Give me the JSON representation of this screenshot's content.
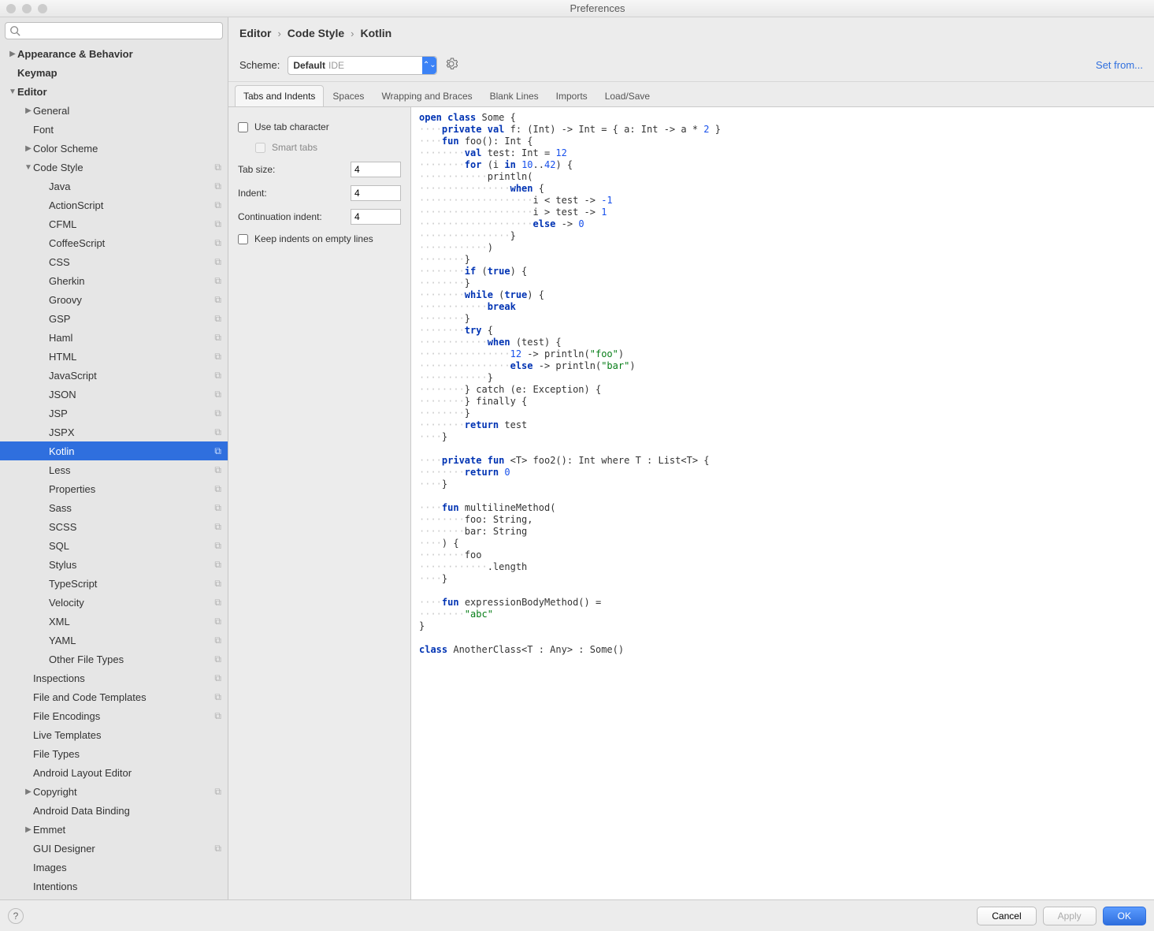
{
  "window": {
    "title": "Preferences"
  },
  "search": {
    "placeholder": ""
  },
  "tree": [
    {
      "label": "Appearance & Behavior",
      "bold": true,
      "indent": 0,
      "disclosure": "right"
    },
    {
      "label": "Keymap",
      "bold": true,
      "indent": 0
    },
    {
      "label": "Editor",
      "bold": true,
      "indent": 0,
      "disclosure": "down"
    },
    {
      "label": "General",
      "indent": 1,
      "disclosure": "right"
    },
    {
      "label": "Font",
      "indent": 1
    },
    {
      "label": "Color Scheme",
      "indent": 1,
      "disclosure": "right"
    },
    {
      "label": "Code Style",
      "indent": 1,
      "disclosure": "down",
      "copy": true
    },
    {
      "label": "Java",
      "indent": 2,
      "copy": true
    },
    {
      "label": "ActionScript",
      "indent": 2,
      "copy": true
    },
    {
      "label": "CFML",
      "indent": 2,
      "copy": true
    },
    {
      "label": "CoffeeScript",
      "indent": 2,
      "copy": true
    },
    {
      "label": "CSS",
      "indent": 2,
      "copy": true
    },
    {
      "label": "Gherkin",
      "indent": 2,
      "copy": true
    },
    {
      "label": "Groovy",
      "indent": 2,
      "copy": true
    },
    {
      "label": "GSP",
      "indent": 2,
      "copy": true
    },
    {
      "label": "Haml",
      "indent": 2,
      "copy": true
    },
    {
      "label": "HTML",
      "indent": 2,
      "copy": true
    },
    {
      "label": "JavaScript",
      "indent": 2,
      "copy": true
    },
    {
      "label": "JSON",
      "indent": 2,
      "copy": true
    },
    {
      "label": "JSP",
      "indent": 2,
      "copy": true
    },
    {
      "label": "JSPX",
      "indent": 2,
      "copy": true
    },
    {
      "label": "Kotlin",
      "indent": 2,
      "copy": true,
      "selected": true
    },
    {
      "label": "Less",
      "indent": 2,
      "copy": true
    },
    {
      "label": "Properties",
      "indent": 2,
      "copy": true
    },
    {
      "label": "Sass",
      "indent": 2,
      "copy": true
    },
    {
      "label": "SCSS",
      "indent": 2,
      "copy": true
    },
    {
      "label": "SQL",
      "indent": 2,
      "copy": true
    },
    {
      "label": "Stylus",
      "indent": 2,
      "copy": true
    },
    {
      "label": "TypeScript",
      "indent": 2,
      "copy": true
    },
    {
      "label": "Velocity",
      "indent": 2,
      "copy": true
    },
    {
      "label": "XML",
      "indent": 2,
      "copy": true
    },
    {
      "label": "YAML",
      "indent": 2,
      "copy": true
    },
    {
      "label": "Other File Types",
      "indent": 2,
      "copy": true
    },
    {
      "label": "Inspections",
      "indent": 1,
      "copy": true
    },
    {
      "label": "File and Code Templates",
      "indent": 1,
      "copy": true
    },
    {
      "label": "File Encodings",
      "indent": 1,
      "copy": true
    },
    {
      "label": "Live Templates",
      "indent": 1
    },
    {
      "label": "File Types",
      "indent": 1
    },
    {
      "label": "Android Layout Editor",
      "indent": 1
    },
    {
      "label": "Copyright",
      "indent": 1,
      "disclosure": "right",
      "copy": true
    },
    {
      "label": "Android Data Binding",
      "indent": 1
    },
    {
      "label": "Emmet",
      "indent": 1,
      "disclosure": "right"
    },
    {
      "label": "GUI Designer",
      "indent": 1,
      "copy": true
    },
    {
      "label": "Images",
      "indent": 1
    },
    {
      "label": "Intentions",
      "indent": 1
    }
  ],
  "breadcrumb": {
    "a": "Editor",
    "b": "Code Style",
    "c": "Kotlin"
  },
  "scheme": {
    "label": "Scheme:",
    "value": "Default",
    "suffix": "IDE",
    "set_from": "Set from..."
  },
  "tabs": {
    "items": [
      "Tabs and Indents",
      "Spaces",
      "Wrapping and Braces",
      "Blank Lines",
      "Imports",
      "Load/Save"
    ],
    "active": 0
  },
  "settings": {
    "use_tab": "Use tab character",
    "smart_tabs": "Smart tabs",
    "tab_size_label": "Tab size:",
    "tab_size": "4",
    "indent_label": "Indent:",
    "indent": "4",
    "cont_label": "Continuation indent:",
    "cont": "4",
    "keep_empty": "Keep indents on empty lines"
  },
  "code": [
    {
      "t": [
        [
          "kw",
          "open"
        ],
        [
          "",
          " "
        ],
        [
          "kw",
          "class"
        ],
        [
          "",
          " Some {"
        ]
      ]
    },
    {
      "d": 4,
      "t": [
        [
          "kw",
          "private"
        ],
        [
          "",
          " "
        ],
        [
          "kw",
          "val"
        ],
        [
          "",
          " f: (Int) -> Int = { a: Int -> a * "
        ],
        [
          "num",
          "2"
        ],
        [
          "",
          " }"
        ]
      ]
    },
    {
      "d": 4,
      "t": [
        [
          "kw",
          "fun"
        ],
        [
          "",
          " foo(): Int {"
        ]
      ]
    },
    {
      "d": 8,
      "t": [
        [
          "kw",
          "val"
        ],
        [
          "",
          " test: Int = "
        ],
        [
          "num",
          "12"
        ]
      ]
    },
    {
      "d": 8,
      "t": [
        [
          "kw",
          "for"
        ],
        [
          "",
          " (i "
        ],
        [
          "kw",
          "in"
        ],
        [
          "",
          " "
        ],
        [
          "num",
          "10"
        ],
        [
          "",
          ".."
        ],
        [
          "num",
          "42"
        ],
        [
          "",
          ") {"
        ]
      ]
    },
    {
      "d": 12,
      "t": [
        [
          "",
          "println("
        ]
      ]
    },
    {
      "d": 16,
      "t": [
        [
          "kw",
          "when"
        ],
        [
          "",
          " {"
        ]
      ]
    },
    {
      "d": 20,
      "t": [
        [
          "",
          "i < test -> "
        ],
        [
          "num",
          "-1"
        ]
      ]
    },
    {
      "d": 20,
      "t": [
        [
          "",
          "i > test -> "
        ],
        [
          "num",
          "1"
        ]
      ]
    },
    {
      "d": 20,
      "t": [
        [
          "kw",
          "else"
        ],
        [
          "",
          " -> "
        ],
        [
          "num",
          "0"
        ]
      ]
    },
    {
      "d": 16,
      "t": [
        [
          "",
          "}"
        ]
      ]
    },
    {
      "d": 12,
      "t": [
        [
          "",
          ")"
        ]
      ]
    },
    {
      "d": 8,
      "t": [
        [
          "",
          "}"
        ]
      ]
    },
    {
      "d": 8,
      "t": [
        [
          "kw",
          "if"
        ],
        [
          "",
          " ("
        ],
        [
          "kw",
          "true"
        ],
        [
          "",
          ") {"
        ]
      ]
    },
    {
      "d": 8,
      "t": [
        [
          "",
          "}"
        ]
      ]
    },
    {
      "d": 8,
      "t": [
        [
          "kw",
          "while"
        ],
        [
          "",
          " ("
        ],
        [
          "kw",
          "true"
        ],
        [
          "",
          ") {"
        ]
      ]
    },
    {
      "d": 12,
      "t": [
        [
          "kw",
          "break"
        ]
      ]
    },
    {
      "d": 8,
      "t": [
        [
          "",
          "}"
        ]
      ]
    },
    {
      "d": 8,
      "t": [
        [
          "kw",
          "try"
        ],
        [
          "",
          " {"
        ]
      ]
    },
    {
      "d": 12,
      "t": [
        [
          "kw",
          "when"
        ],
        [
          "",
          " (test) {"
        ]
      ]
    },
    {
      "d": 16,
      "t": [
        [
          "num",
          "12"
        ],
        [
          "",
          " -> println("
        ],
        [
          "str",
          "\"foo\""
        ],
        [
          "",
          ")"
        ]
      ]
    },
    {
      "d": 16,
      "t": [
        [
          "kw",
          "else"
        ],
        [
          "",
          " -> println("
        ],
        [
          "str",
          "\"bar\""
        ],
        [
          "",
          ")"
        ]
      ]
    },
    {
      "d": 12,
      "t": [
        [
          "",
          "}"
        ]
      ]
    },
    {
      "d": 8,
      "t": [
        [
          "",
          "} catch (e: Exception) {"
        ]
      ]
    },
    {
      "d": 8,
      "t": [
        [
          "",
          "} finally {"
        ]
      ]
    },
    {
      "d": 8,
      "t": [
        [
          "",
          "}"
        ]
      ]
    },
    {
      "d": 8,
      "t": [
        [
          "kw",
          "return"
        ],
        [
          "",
          " test"
        ]
      ]
    },
    {
      "d": 4,
      "t": [
        [
          "",
          "}"
        ]
      ]
    },
    {
      "t": [
        [
          "",
          ""
        ]
      ]
    },
    {
      "d": 4,
      "t": [
        [
          "kw",
          "private"
        ],
        [
          "",
          " "
        ],
        [
          "kw",
          "fun"
        ],
        [
          "",
          " <T> foo2(): Int where T : List<T> {"
        ]
      ]
    },
    {
      "d": 8,
      "t": [
        [
          "kw",
          "return"
        ],
        [
          "",
          " "
        ],
        [
          "num",
          "0"
        ]
      ]
    },
    {
      "d": 4,
      "t": [
        [
          "",
          "}"
        ]
      ]
    },
    {
      "t": [
        [
          "",
          ""
        ]
      ]
    },
    {
      "d": 4,
      "t": [
        [
          "kw",
          "fun"
        ],
        [
          "",
          " multilineMethod("
        ]
      ]
    },
    {
      "d": 8,
      "t": [
        [
          "",
          "foo: String,"
        ]
      ]
    },
    {
      "d": 8,
      "t": [
        [
          "",
          "bar: String"
        ]
      ]
    },
    {
      "d": 4,
      "t": [
        [
          "",
          ") {"
        ]
      ]
    },
    {
      "d": 8,
      "t": [
        [
          "",
          "foo"
        ]
      ]
    },
    {
      "d": 12,
      "t": [
        [
          "",
          ".length"
        ]
      ]
    },
    {
      "d": 4,
      "t": [
        [
          "",
          "}"
        ]
      ]
    },
    {
      "t": [
        [
          "",
          ""
        ]
      ]
    },
    {
      "d": 4,
      "t": [
        [
          "kw",
          "fun"
        ],
        [
          "",
          " expressionBodyMethod() ="
        ]
      ]
    },
    {
      "d": 8,
      "t": [
        [
          "str",
          "\"abc\""
        ]
      ]
    },
    {
      "t": [
        [
          "",
          "}"
        ]
      ]
    },
    {
      "t": [
        [
          "",
          ""
        ]
      ]
    },
    {
      "t": [
        [
          "kw",
          "class"
        ],
        [
          "",
          " AnotherClass<T : Any> : Some()"
        ]
      ]
    }
  ],
  "buttons": {
    "cancel": "Cancel",
    "apply": "Apply",
    "ok": "OK"
  }
}
